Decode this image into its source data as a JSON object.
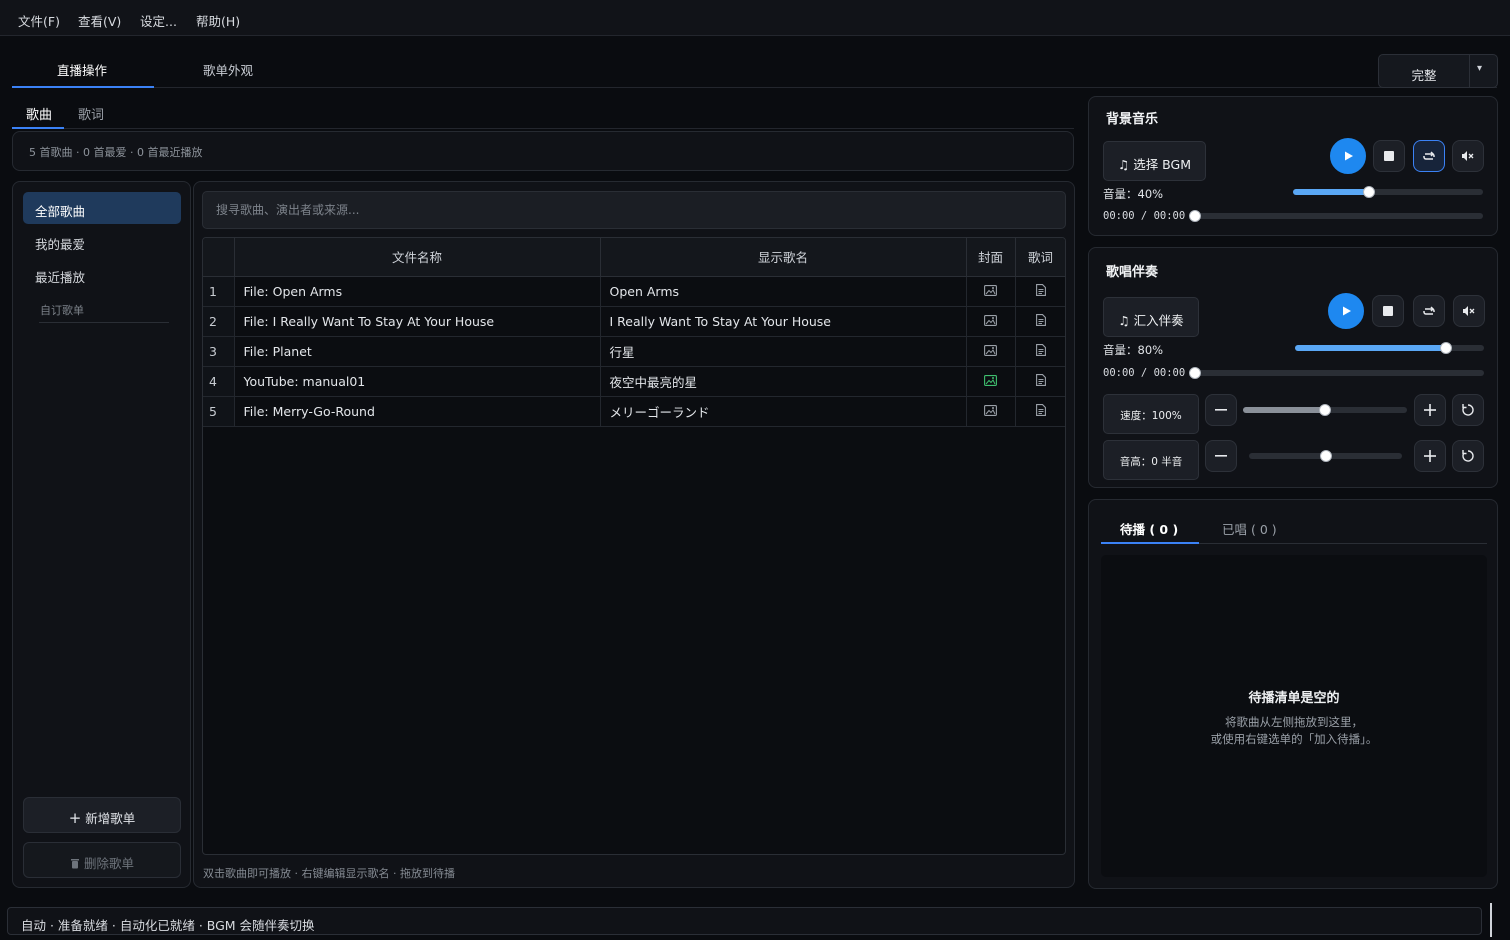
{
  "menu": [
    "文件(F)",
    "查看(V)",
    "设定...",
    "帮助(H)"
  ],
  "main_tabs": [
    "直播操作",
    "歌单外观"
  ],
  "mode_button": {
    "label": "完整",
    "caret": "▾"
  },
  "sub_tabs": [
    "歌曲",
    "歌词"
  ],
  "stats": "5 首歌曲 · 0 首最爱 · 0 首最近播放",
  "sidebar": {
    "items": [
      "全部歌曲",
      "我的最爱",
      "最近播放"
    ],
    "custom_header": "自订歌单",
    "add_button": "新增歌单",
    "delete_button": "删除歌单"
  },
  "search": {
    "placeholder": "搜寻歌曲、演出者或来源..."
  },
  "table": {
    "headers": [
      "文件名称",
      "显示歌名",
      "封面",
      "歌词"
    ],
    "rows": [
      {
        "num": "1",
        "file": "File: Open Arms",
        "display": "Open Arms",
        "cover_set": false
      },
      {
        "num": "2",
        "file": "File: I Really Want To Stay At Your House",
        "display": "I Really Want To Stay At Your House",
        "cover_set": false
      },
      {
        "num": "3",
        "file": "File: Planet",
        "display": "行星",
        "cover_set": false
      },
      {
        "num": "4",
        "file": "YouTube: manual01",
        "display": "夜空中最亮的星",
        "cover_set": true
      },
      {
        "num": "5",
        "file": "File: Merry-Go-Round",
        "display": "メリーゴーランド",
        "cover_set": false
      }
    ]
  },
  "hint": "双击歌曲即可播放 · 右键编辑显示歌名 · 拖放到待播",
  "bgm": {
    "title": "背景音乐",
    "select_button": "选择 BGM",
    "volume_label": "音量：40%",
    "volume": 0.4,
    "time": "00:00 / 00:00",
    "progress": 0
  },
  "accompaniment": {
    "title": "歌唱伴奏",
    "import_button": "汇入伴奏",
    "volume_label": "音量：80%",
    "volume": 0.8,
    "time": "00:00 / 00:00",
    "progress": 0,
    "speed_label": "速度：100%",
    "speed": 0.5,
    "pitch_label": "音高：0 半音",
    "pitch": 0.5
  },
  "queue": {
    "tabs": [
      "待播 ( 0 )",
      "已唱 ( 0 )"
    ],
    "empty_title": "待播清单是空的",
    "empty_line1": "将歌曲从左侧拖放到这里，",
    "empty_line2": "或使用右键选单的「加入待播」。"
  },
  "status": "自动 · 准备就绪 · 自动化已就绪 · BGM 会随伴奏切换",
  "colors": {
    "accent": "#1e88f0",
    "cover_set": "#3fbf6f"
  }
}
